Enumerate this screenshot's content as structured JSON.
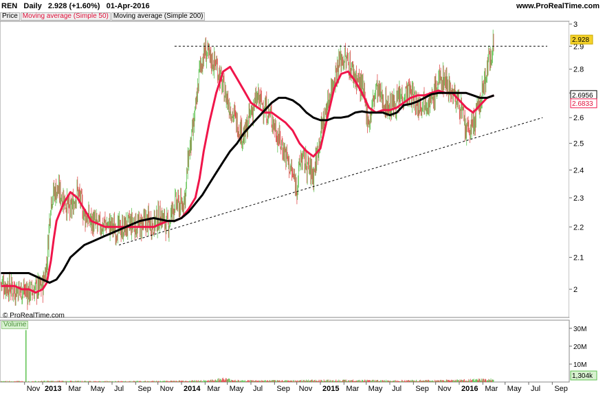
{
  "header": {
    "symbol": "REN",
    "period": "Daily",
    "price": "2.928",
    "change": "(+1.60%)",
    "date": "01-Apr-2016",
    "site": "www.ProRealTime.com"
  },
  "legend": {
    "price": "Price",
    "ma50": "Moving average (Simple 50)",
    "ma200": "Moving average (Simple 200)"
  },
  "credit": "© ProRealTime.com",
  "volume_label": "Volume",
  "colors": {
    "up": "#5cc24f",
    "down": "#e04b4b",
    "ma50": "#f0154a",
    "ma200": "#000000",
    "last_price_tag": "#f5d22a",
    "ma50_tag_text": "#e0103a"
  },
  "chart_data": {
    "type": "line",
    "y_axis": {
      "ticks": [
        2,
        2.1,
        2.2,
        2.3,
        2.4,
        2.5,
        2.6,
        2.7,
        2.8,
        2.9,
        3
      ],
      "tick_labels": [
        "2",
        "2.1",
        "2.2",
        "2.3",
        "2.4",
        "2.5",
        "2.6",
        "2.7",
        "2.8",
        "2.9",
        "3"
      ],
      "ylim": [
        1.95,
        3.03
      ],
      "scale": "log"
    },
    "x_axis": {
      "labels": [
        "Nov",
        "2013",
        "Mar",
        "May",
        "Jul",
        "Sep",
        "Nov",
        "2014",
        "Mar",
        "May",
        "Jul",
        "Sep",
        "Nov",
        "2015",
        "Mar",
        "May",
        "Jul",
        "Sep",
        "Nov",
        "2016",
        "Mar",
        "May",
        "Jul",
        "Sep"
      ],
      "bold": [
        "2013",
        "2014",
        "2015",
        "2016"
      ],
      "t": [
        -0.13,
        0.0,
        0.17,
        0.33,
        0.5,
        0.67,
        0.83,
        1.0,
        1.17,
        1.33,
        1.5,
        1.67,
        1.83,
        2.0,
        2.17,
        2.33,
        2.5,
        2.67,
        2.83,
        3.0,
        3.17,
        3.33,
        3.5,
        3.67
      ]
    },
    "price_series": {
      "name": "Price",
      "t": [
        -0.3,
        -0.25,
        -0.2,
        -0.15,
        -0.1,
        -0.05,
        0.0,
        0.03,
        0.06,
        0.1,
        0.15,
        0.2,
        0.25,
        0.3,
        0.35,
        0.4,
        0.45,
        0.5,
        0.55,
        0.6,
        0.65,
        0.7,
        0.75,
        0.8,
        0.85,
        0.9,
        0.95,
        1.0,
        1.03,
        1.05,
        1.07,
        1.1,
        1.13,
        1.17,
        1.2,
        1.25,
        1.3,
        1.35,
        1.4,
        1.45,
        1.5,
        1.55,
        1.6,
        1.65,
        1.7,
        1.75,
        1.8,
        1.83,
        1.86,
        1.9,
        1.95,
        2.0,
        2.05,
        2.1,
        2.15,
        2.2,
        2.25,
        2.3,
        2.35,
        2.4,
        2.45,
        2.5,
        2.55,
        2.6,
        2.65,
        2.7,
        2.75,
        2.8,
        2.85,
        2.9,
        2.95,
        3.0,
        3.05,
        3.1,
        3.15,
        3.2,
        3.25
      ],
      "close": [
        2.02,
        2.01,
        2.0,
        2.0,
        1.99,
        2.0,
        2.01,
        2.08,
        2.3,
        2.33,
        2.3,
        2.25,
        2.33,
        2.24,
        2.22,
        2.2,
        2.21,
        2.2,
        2.19,
        2.2,
        2.21,
        2.2,
        2.22,
        2.21,
        2.24,
        2.2,
        2.28,
        2.27,
        2.32,
        2.45,
        2.5,
        2.62,
        2.8,
        2.88,
        2.85,
        2.82,
        2.72,
        2.64,
        2.58,
        2.52,
        2.62,
        2.68,
        2.64,
        2.6,
        2.52,
        2.46,
        2.38,
        2.34,
        2.45,
        2.42,
        2.38,
        2.54,
        2.65,
        2.77,
        2.85,
        2.83,
        2.77,
        2.72,
        2.58,
        2.72,
        2.67,
        2.64,
        2.66,
        2.7,
        2.7,
        2.65,
        2.68,
        2.66,
        2.75,
        2.76,
        2.7,
        2.66,
        2.54,
        2.57,
        2.66,
        2.8,
        2.928
      ],
      "color_up": "#5cc24f",
      "color_down": "#e04b4b"
    },
    "series": [
      {
        "name": "Moving average (Simple 50)",
        "t": [
          -0.3,
          -0.25,
          -0.2,
          -0.15,
          -0.1,
          -0.05,
          0.0,
          0.03,
          0.06,
          0.08,
          0.1,
          0.15,
          0.2,
          0.25,
          0.3,
          0.35,
          0.4,
          0.45,
          0.5,
          0.55,
          0.6,
          0.65,
          0.7,
          0.75,
          0.8,
          0.85,
          0.9,
          0.95,
          1.0,
          1.05,
          1.1,
          1.13,
          1.16,
          1.2,
          1.25,
          1.3,
          1.35,
          1.4,
          1.45,
          1.5,
          1.55,
          1.6,
          1.65,
          1.7,
          1.75,
          1.8,
          1.85,
          1.9,
          1.95,
          2.0,
          2.05,
          2.1,
          2.15,
          2.2,
          2.25,
          2.3,
          2.35,
          2.4,
          2.45,
          2.5,
          2.55,
          2.6,
          2.65,
          2.7,
          2.75,
          2.8,
          2.85,
          2.9,
          2.95,
          3.0,
          3.05,
          3.1,
          3.15,
          3.2,
          3.25
        ],
        "values": [
          2.01,
          2.01,
          2.01,
          2.0,
          2.0,
          1.99,
          2.0,
          2.02,
          2.09,
          2.16,
          2.22,
          2.28,
          2.32,
          2.3,
          2.26,
          2.22,
          2.21,
          2.2,
          2.2,
          2.2,
          2.2,
          2.2,
          2.2,
          2.2,
          2.2,
          2.21,
          2.22,
          2.22,
          2.23,
          2.26,
          2.3,
          2.37,
          2.47,
          2.58,
          2.7,
          2.79,
          2.81,
          2.76,
          2.71,
          2.66,
          2.64,
          2.62,
          2.62,
          2.6,
          2.58,
          2.55,
          2.5,
          2.47,
          2.45,
          2.48,
          2.6,
          2.72,
          2.78,
          2.79,
          2.75,
          2.7,
          2.64,
          2.62,
          2.63,
          2.63,
          2.64,
          2.66,
          2.68,
          2.69,
          2.69,
          2.7,
          2.71,
          2.7,
          2.7,
          2.67,
          2.64,
          2.62,
          2.65,
          2.68,
          2.69
        ],
        "color": "#f0154a",
        "last_label": "2.6833"
      },
      {
        "name": "Moving average (Simple 200)",
        "t": [
          -0.3,
          -0.25,
          -0.2,
          -0.15,
          -0.1,
          -0.05,
          0.0,
          0.05,
          0.1,
          0.15,
          0.2,
          0.25,
          0.3,
          0.35,
          0.4,
          0.45,
          0.5,
          0.55,
          0.6,
          0.65,
          0.7,
          0.75,
          0.8,
          0.85,
          0.9,
          0.95,
          1.0,
          1.05,
          1.1,
          1.15,
          1.2,
          1.25,
          1.3,
          1.35,
          1.4,
          1.45,
          1.5,
          1.55,
          1.6,
          1.65,
          1.7,
          1.75,
          1.8,
          1.85,
          1.9,
          1.95,
          2.0,
          2.05,
          2.1,
          2.15,
          2.2,
          2.25,
          2.3,
          2.35,
          2.4,
          2.45,
          2.5,
          2.55,
          2.6,
          2.65,
          2.7,
          2.75,
          2.8,
          2.85,
          2.9,
          2.95,
          3.0,
          3.05,
          3.1,
          3.15,
          3.2,
          3.25
        ],
        "values": [
          2.05,
          2.05,
          2.05,
          2.05,
          2.05,
          2.04,
          2.03,
          2.02,
          2.03,
          2.06,
          2.1,
          2.12,
          2.14,
          2.15,
          2.16,
          2.17,
          2.18,
          2.19,
          2.2,
          2.21,
          2.22,
          2.225,
          2.23,
          2.225,
          2.22,
          2.22,
          2.23,
          2.25,
          2.28,
          2.31,
          2.35,
          2.39,
          2.43,
          2.47,
          2.5,
          2.54,
          2.57,
          2.6,
          2.63,
          2.66,
          2.68,
          2.68,
          2.67,
          2.65,
          2.62,
          2.6,
          2.59,
          2.59,
          2.6,
          2.6,
          2.605,
          2.62,
          2.625,
          2.62,
          2.62,
          2.62,
          2.61,
          2.62,
          2.65,
          2.655,
          2.665,
          2.68,
          2.695,
          2.7,
          2.7,
          2.7,
          2.7,
          2.7,
          2.69,
          2.68,
          2.68,
          2.69
        ],
        "color": "#000000",
        "last_label": "2.6956"
      }
    ],
    "resistance_line": {
      "t": [
        0.95,
        3.8
      ],
      "values": [
        2.9,
        2.9
      ],
      "style": "dashed"
    },
    "support_line": {
      "t": [
        0.55,
        3.6
      ],
      "values": [
        2.14,
        2.6
      ],
      "style": "dashed"
    },
    "last_price_label": "2.928",
    "volume": {
      "tick_labels": [
        "30M",
        "20M",
        "10M"
      ],
      "tick_values": [
        30,
        20,
        10
      ],
      "ylim": [
        0,
        33
      ],
      "last_label": "1,304k",
      "spike": {
        "t": -0.12,
        "value": 29
      },
      "t": [
        -0.3,
        -0.2,
        -0.1,
        0.0,
        0.2,
        0.4,
        0.6,
        0.8,
        1.0,
        1.2,
        1.3,
        1.4,
        1.6,
        1.8,
        2.0,
        2.2,
        2.4,
        2.6,
        2.8,
        3.0,
        3.2
      ],
      "values": [
        0.4,
        0.4,
        0.4,
        0.5,
        0.5,
        0.4,
        0.4,
        0.5,
        0.6,
        0.8,
        1.6,
        0.8,
        0.7,
        0.8,
        0.9,
        0.9,
        0.8,
        0.8,
        0.8,
        1.0,
        1.3
      ]
    }
  }
}
